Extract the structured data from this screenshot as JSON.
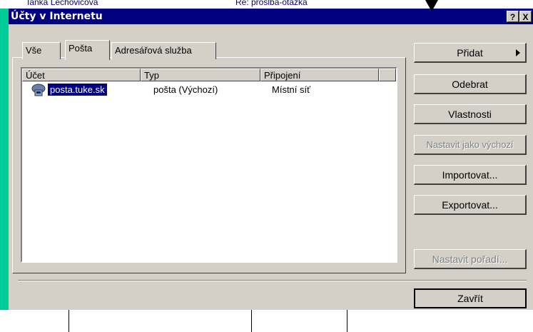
{
  "background": {
    "top_left_text": "Ianka Lechovicová",
    "top_right_text": "Re: proslba-otázka"
  },
  "dialog": {
    "title": "Účty v Internetu",
    "help_button": "?",
    "close_button": "X"
  },
  "tabs": [
    {
      "label": "Vše",
      "active": false
    },
    {
      "label": "Pošta",
      "active": true
    },
    {
      "label": "Adresářová služba",
      "active": false
    }
  ],
  "list": {
    "columns": [
      "Účet",
      "Typ",
      "Připojení"
    ],
    "rows": [
      {
        "account": "posta.tuke.sk",
        "type": "pošta (Výchozí)",
        "connection": "Místní síť",
        "selected": true
      }
    ]
  },
  "buttons": {
    "add": "Přidat",
    "remove": "Odebrat",
    "properties": "Vlastnosti",
    "set_default": "Nastavit jako výchozí",
    "import": "Importovat...",
    "export": "Exportovat...",
    "set_order": "Nastavit pořadí...",
    "close": "Zavřít"
  },
  "colors": {
    "window_frame": "#00cc99",
    "title_bar": "#000080",
    "face": "#d4d0c8",
    "selection": "#000080"
  }
}
